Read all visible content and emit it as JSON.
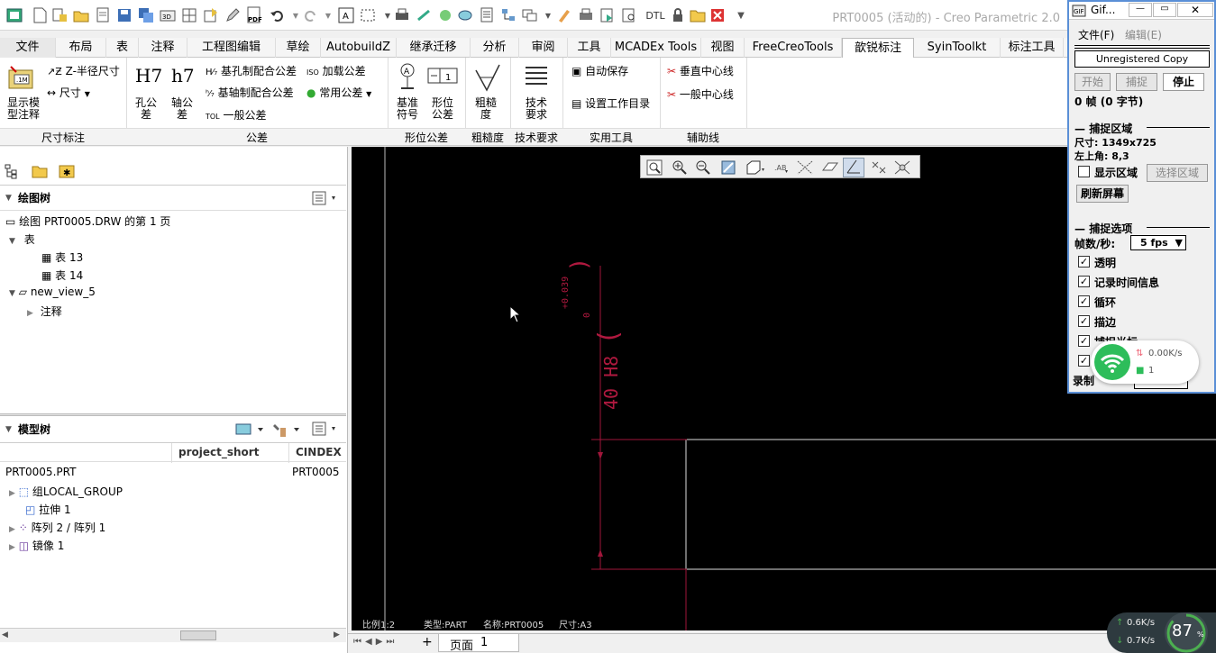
{
  "window": {
    "title": "PRT0005 (活动的) - Creo Parametric 2.0"
  },
  "quick_access": {
    "icons": [
      "new-icon",
      "open-icon",
      "save-icon",
      "print-icon",
      "regenerate-icon",
      "windows-icon",
      "close-icon",
      "undo-icon",
      "redo-icon",
      "select-box-icon",
      "repaint-icon",
      "saved-views-icon",
      "pdf-icon",
      "dtl-label"
    ],
    "dtl": "DTL"
  },
  "tabs": [
    "文件",
    "布局",
    "表",
    "注释",
    "工程图编辑",
    "草绘",
    "AutobuildZ",
    "继承迁移",
    "分析",
    "审阅",
    "工具",
    "MCADEx Tools",
    "视图",
    "FreeCreoTools",
    "歆锐标注",
    "SyinToolkt",
    "标注工具"
  ],
  "ribbon": {
    "show_model_annotation": "显示模\n型注释",
    "z_radius": "Z-半径尺寸",
    "dimension": "尺寸",
    "hole_tol": {
      "symbol": "H7",
      "label": "孔公\n差"
    },
    "shaft_tol": {
      "symbol": "h7",
      "label": "轴公\n差"
    },
    "hole_basis": "基孔制配合公差",
    "shaft_basis": "基轴制配合公差",
    "general_tol": "一般公差",
    "tol_prefix": "TOL",
    "iso_tol": "加载公差",
    "iso_prefix": "ISO",
    "common_tol": "常用公差",
    "datum_symbol": "基准\n符号",
    "position_tol": "形位\n公差",
    "roughness": "粗糙\n度",
    "tech_req": "技术\n要求",
    "auto_save": "自动保存",
    "set_workdir": "设置工作目录",
    "vertical_center": "垂直中心线",
    "general_center": "一般中心线"
  },
  "groups": [
    "尺寸标注",
    "公差",
    "形位公差",
    "粗糙度",
    "技术要求",
    "实用工具",
    "辅助线"
  ],
  "left_panel": {
    "drawing_tree_title": "绘图树",
    "drawing_tree": {
      "root": "绘图 PRT0005.DRW 的第 1 页",
      "table": "表",
      "table13": "表 13",
      "table14": "表 14",
      "view": "new_view_5",
      "notes": "注释"
    },
    "model_tree_title": "模型树",
    "columns": {
      "project": "project_short",
      "cindex": "CINDEX"
    },
    "model_tree": {
      "root": "PRT0005.PRT",
      "root_cindex": "PRT0005",
      "items": [
        "组LOCAL_GROUP",
        "拉伸 1",
        "阵列 2 / 阵列 1",
        "镜像 1"
      ]
    }
  },
  "canvas": {
    "dimension_text": "40 H8",
    "tol_upper": "+0.039",
    "tol_lower": "0",
    "status": {
      "scale": "比例1:2",
      "type": "类型:PART",
      "name": "名称:PRT0005",
      "size": "尺寸:A3"
    }
  },
  "page_bar": {
    "label": "页面",
    "page": "1"
  },
  "gifcam": {
    "title": "Gif...",
    "menu_file": "文件(F)",
    "menu_edit": "编辑(E)",
    "unregistered": "Unregistered Copy",
    "btn_start": "开始",
    "btn_capture": "捕捉",
    "btn_stop": "停止",
    "frames": "0 帧 (0 字节)",
    "capture_area_title": "捕捉区域",
    "size": "尺寸: 1349x725",
    "topleft": "左上角: 8,3",
    "show_area": "显示区域",
    "select_area": "选择区域",
    "refresh": "刷新屏幕",
    "capture_options_title": "捕捉选项",
    "fps_label": "帧数/秒:",
    "fps_value": "5 fps",
    "opt_transparent": "透明",
    "opt_time": "记录时间信息",
    "opt_loop": "循环",
    "opt_border": "描边",
    "opt_cursor": "捕捉光标",
    "record_label": "录制",
    "net_speed": "0.00K/s",
    "net_count": "1"
  },
  "sys_monitor": {
    "up": "0.6K/s",
    "down": "0.7K/s",
    "percent": "87"
  }
}
